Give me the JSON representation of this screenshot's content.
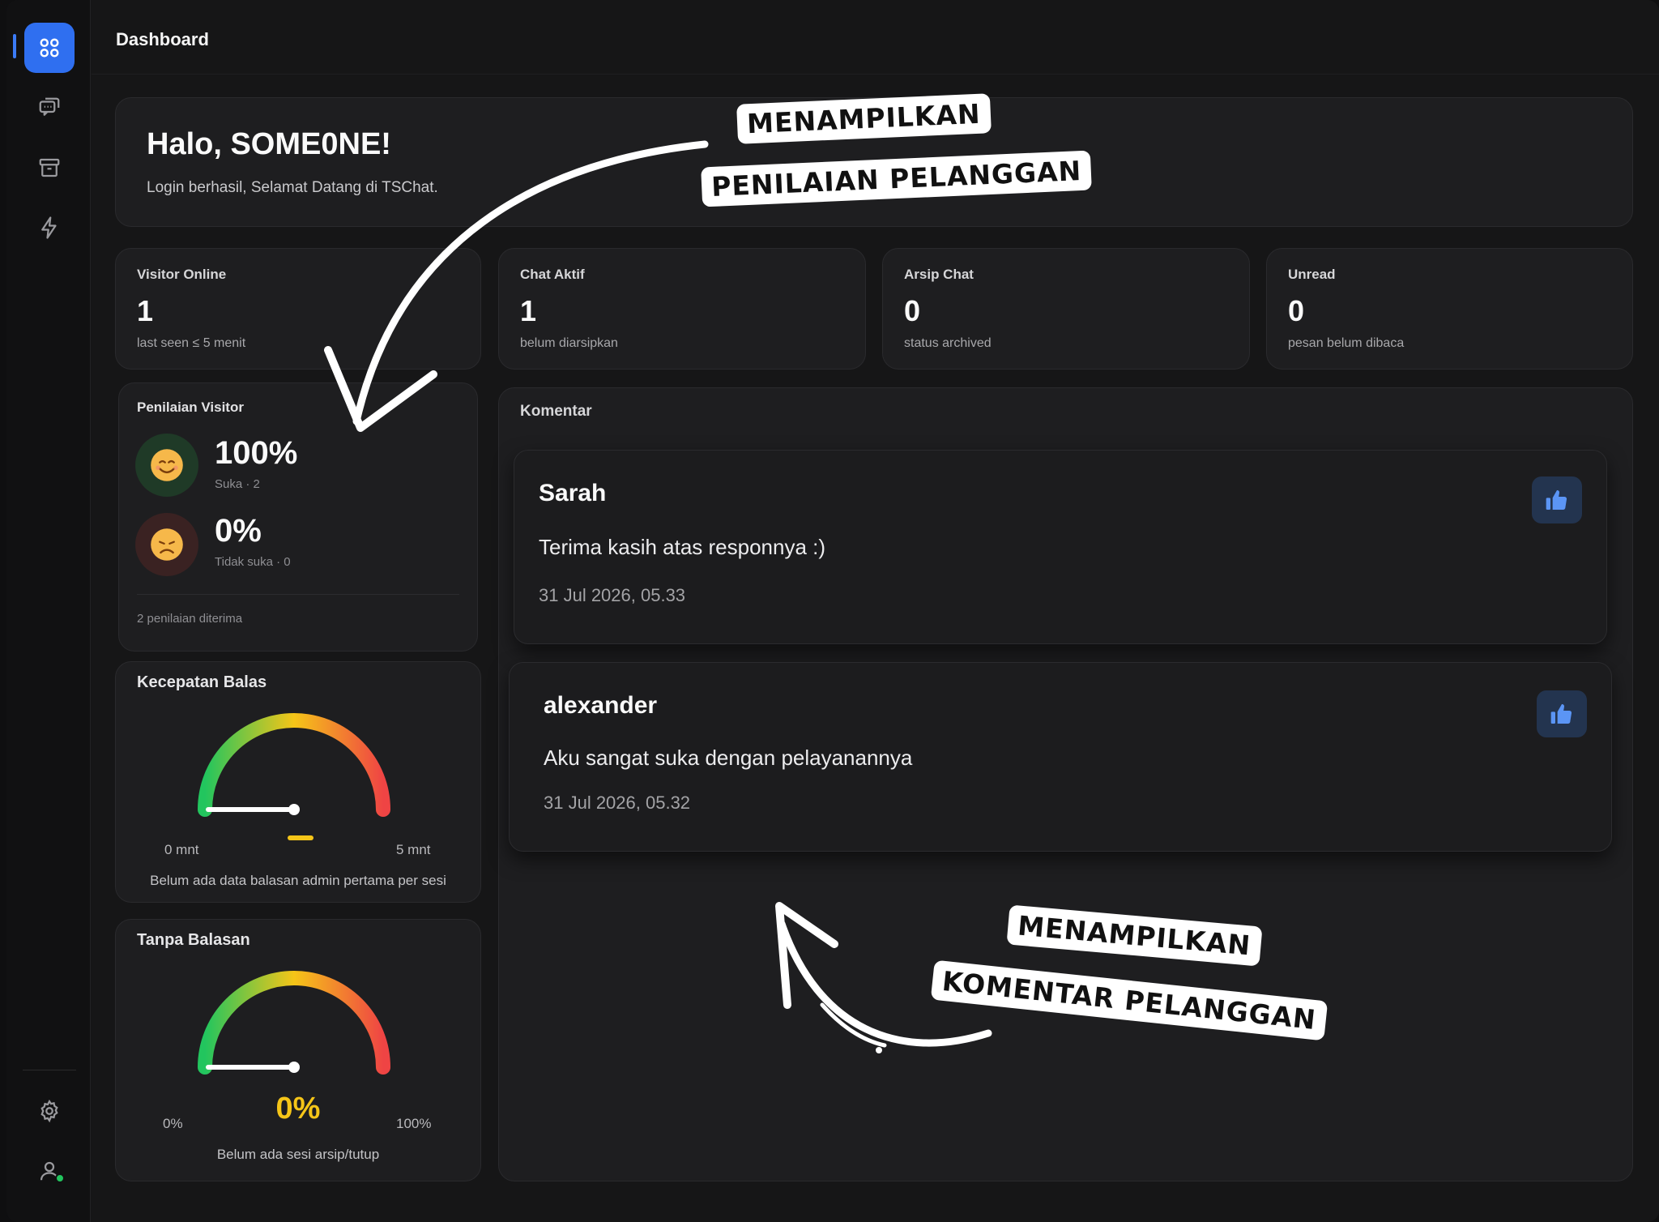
{
  "topbar": {
    "title": "Dashboard"
  },
  "welcome": {
    "title": "Halo, SOME0NE!",
    "subtitle": "Login berhasil, Selamat Datang di TSChat."
  },
  "stats": [
    {
      "label": "Visitor Online",
      "value": "1",
      "sub": "last seen ≤ 5 menit"
    },
    {
      "label": "Chat Aktif",
      "value": "1",
      "sub": "belum diarsipkan"
    },
    {
      "label": "Arsip Chat",
      "value": "0",
      "sub": "status archived"
    },
    {
      "label": "Unread",
      "value": "0",
      "sub": "pesan belum dibaca"
    }
  ],
  "rating": {
    "title": "Penilaian Visitor",
    "like": {
      "pct": "100%",
      "sub": "Suka · 2"
    },
    "dislike": {
      "pct": "0%",
      "sub": "Tidak suka · 0"
    },
    "footer": "2 penilaian diterima"
  },
  "speed_gauge": {
    "title": "Kecepatan Balas",
    "min": "0 mnt",
    "max": "5 mnt",
    "footer": "Belum ada data balasan admin pertama per sesi",
    "level": 0
  },
  "noreply_gauge": {
    "title": "Tanpa Balasan",
    "min": "0%",
    "max": "100%",
    "value": "0%",
    "footer": "Belum ada sesi arsip/tutup",
    "level": 0
  },
  "comments": {
    "title": "Komentar",
    "items": [
      {
        "name": "Sarah",
        "text": "Terima kasih atas responnya :)",
        "date": "31 Jul 2026, 05.33"
      },
      {
        "name": "alexander",
        "text": "Aku sangat suka dengan pelayanannya",
        "date": "31 Jul 2026, 05.32"
      }
    ]
  },
  "annotations": {
    "top_line1": "MENAMPILKAN",
    "top_line2": "PENILAIAN PELANGGAN",
    "bottom_line1": "MENAMPILKAN",
    "bottom_line2": "KOMENTAR PELANGGAN"
  },
  "colors": {
    "accent": "#2f6ff0",
    "online": "#22c55e",
    "gauge_value": "#f5c518",
    "like_bg": "#23344f"
  },
  "icons": {
    "sidebar": [
      "grid-icon",
      "chat-icon",
      "archive-icon",
      "bolt-icon",
      "gear-icon",
      "user-icon"
    ],
    "comment_action": "thumbs-up-icon"
  }
}
